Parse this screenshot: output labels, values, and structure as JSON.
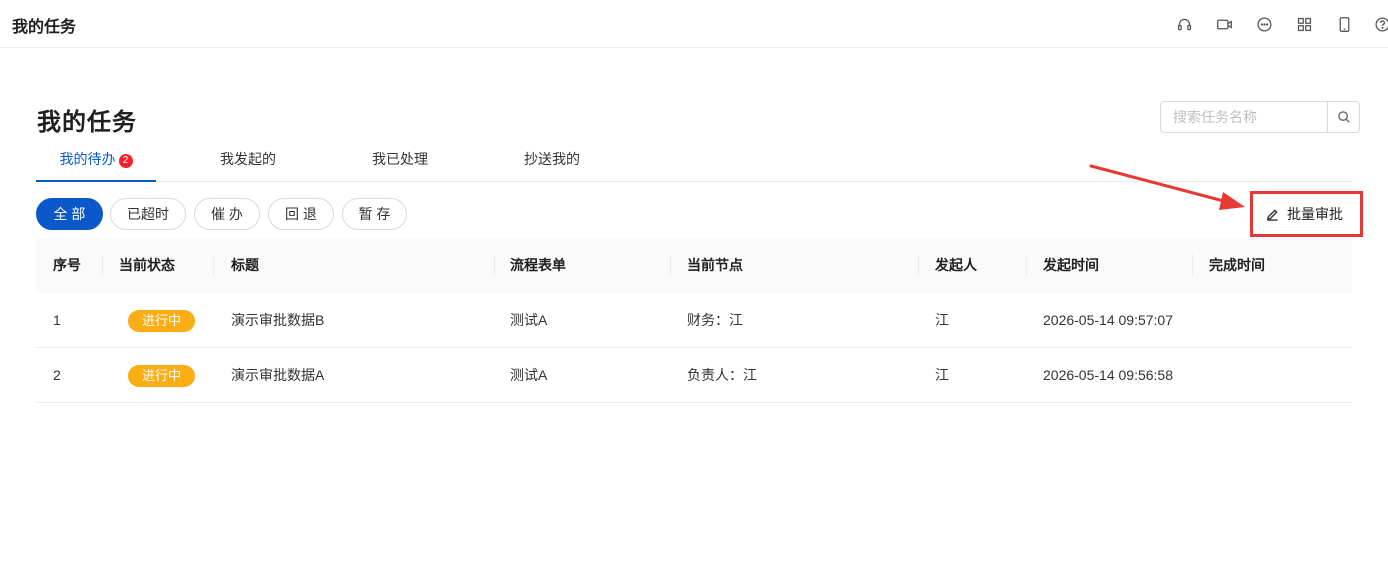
{
  "app": {
    "title": "我的任务"
  },
  "topbar_icons": [
    "headset-icon",
    "video-icon",
    "chat-icon",
    "apps-icon",
    "mobile-icon",
    "help-icon"
  ],
  "page": {
    "title": "我的任务"
  },
  "search": {
    "placeholder": "搜索任务名称",
    "value": ""
  },
  "tabs": [
    {
      "label": "我的待办",
      "badge": "2",
      "active": true
    },
    {
      "label": "我发起的"
    },
    {
      "label": "我已处理"
    },
    {
      "label": "抄送我的"
    }
  ],
  "filters": [
    {
      "label": "全 部",
      "active": true
    },
    {
      "label": "已超时"
    },
    {
      "label": "催 办"
    },
    {
      "label": "回 退"
    },
    {
      "label": "暂 存"
    }
  ],
  "batch": {
    "label": "批量审批"
  },
  "table": {
    "columns": [
      "序号",
      "当前状态",
      "标题",
      "流程表单",
      "当前节点",
      "发起人",
      "发起时间",
      "完成时间"
    ],
    "rows": [
      {
        "index": "1",
        "status": "进行中",
        "title": "演示审批数据B",
        "form": "测试A",
        "node": "财务：江",
        "initiator": "江",
        "start_time": "2026-05-14 09:57:07",
        "end_time": ""
      },
      {
        "index": "2",
        "status": "进行中",
        "title": "演示审批数据A",
        "form": "测试A",
        "node": "负责人：江",
        "initiator": "江",
        "start_time": "2026-05-14 09:56:58",
        "end_time": ""
      }
    ]
  },
  "colors": {
    "primary": "#0a58ca",
    "status_in_progress": "#faad14",
    "highlight": "#e53935",
    "badge": "#f5222d"
  }
}
